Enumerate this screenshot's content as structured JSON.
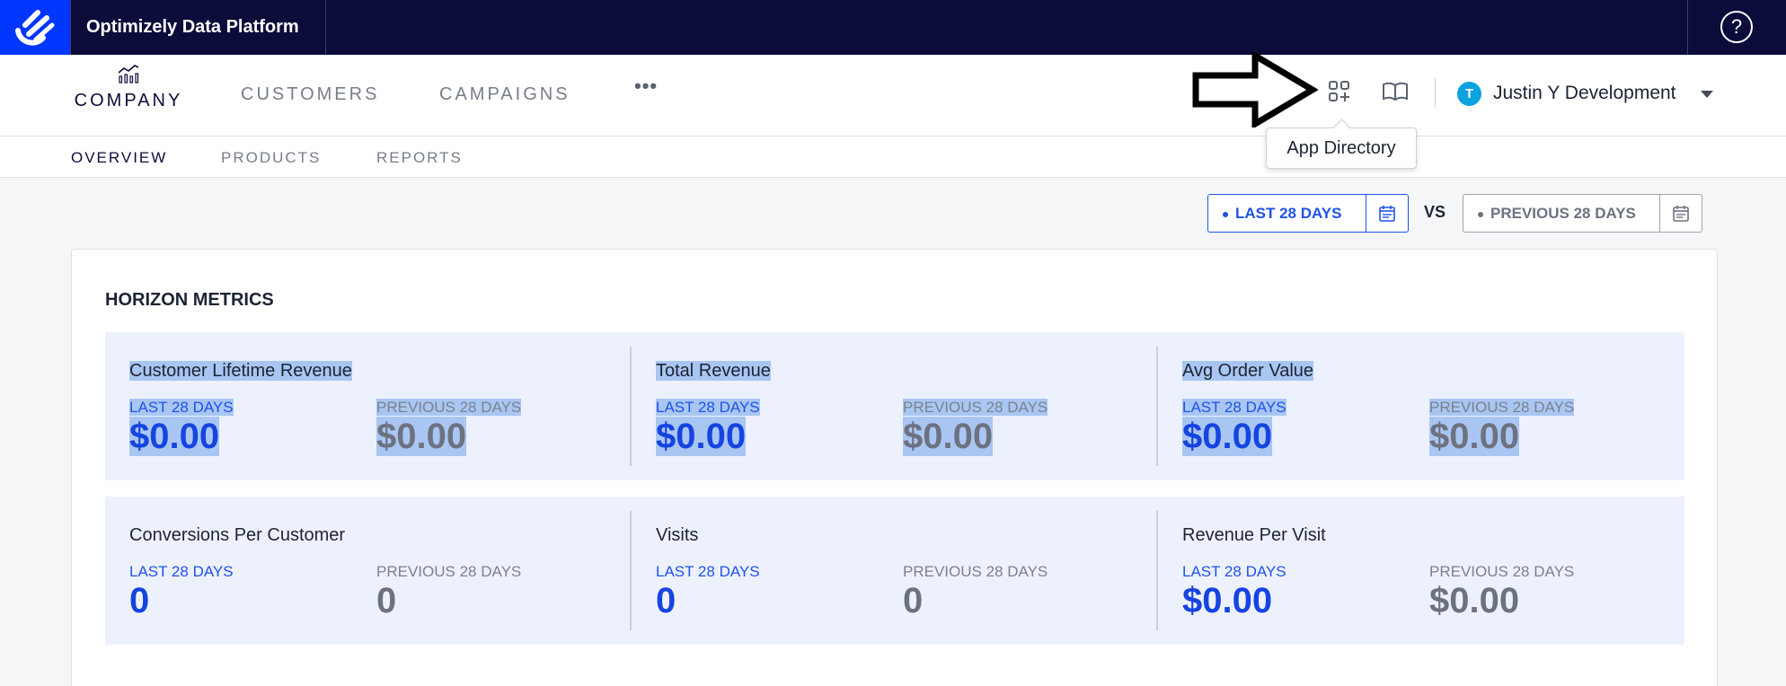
{
  "topbar": {
    "app_title": "Optimizely Data Platform",
    "help_label": "?"
  },
  "mainnav": {
    "company_label": "COMPANY",
    "customers_label": "CUSTOMERS",
    "campaigns_label": "CAMPAIGNS",
    "more_label": "•••",
    "tooltip": "App Directory",
    "avatar_initial": "T",
    "org_name": "Justin Y Development"
  },
  "subnav": {
    "items": [
      {
        "label": "OVERVIEW",
        "active": true
      },
      {
        "label": "PRODUCTS",
        "active": false
      },
      {
        "label": "REPORTS",
        "active": false
      }
    ]
  },
  "dates": {
    "current_label": "LAST 28 DAYS",
    "vs_label": "VS",
    "previous_label": "PREVIOUS 28 DAYS"
  },
  "horizon": {
    "title": "HORIZON METRICS",
    "rows": [
      [
        {
          "title": "Customer Lifetime Revenue",
          "cur_label": "LAST 28 DAYS",
          "cur_value": "$0.00",
          "prev_label": "PREVIOUS 28 DAYS",
          "prev_value": "$0.00"
        },
        {
          "title": "Total Revenue",
          "cur_label": "LAST 28 DAYS",
          "cur_value": "$0.00",
          "prev_label": "PREVIOUS 28 DAYS",
          "prev_value": "$0.00"
        },
        {
          "title": "Avg Order Value",
          "cur_label": "LAST 28 DAYS",
          "cur_value": "$0.00",
          "prev_label": "PREVIOUS 28 DAYS",
          "prev_value": "$0.00"
        }
      ],
      [
        {
          "title": "Conversions Per Customer",
          "cur_label": "LAST 28 DAYS",
          "cur_value": "0",
          "prev_label": "PREVIOUS 28 DAYS",
          "prev_value": "0"
        },
        {
          "title": "Visits",
          "cur_label": "LAST 28 DAYS",
          "cur_value": "0",
          "prev_label": "PREVIOUS 28 DAYS",
          "prev_value": "0"
        },
        {
          "title": "Revenue Per Visit",
          "cur_label": "LAST 28 DAYS",
          "cur_value": "$0.00",
          "prev_label": "PREVIOUS 28 DAYS",
          "prev_value": "$0.00"
        }
      ]
    ]
  },
  "colors": {
    "topbar_bg": "#0b0c3a",
    "brand_blue": "#0037ff",
    "accent_blue": "#1644e0",
    "metric_bg": "#edf1fd",
    "selection": "#a9c6f3"
  },
  "icons": {
    "logo": "optimizely-logo-icon",
    "company": "bar-chart-icon",
    "settings": "gear-icon",
    "app_directory": "app-directory-icon",
    "docs": "book-icon",
    "calendar": "calendar-icon",
    "annotation": "arrow-pointer-icon"
  }
}
